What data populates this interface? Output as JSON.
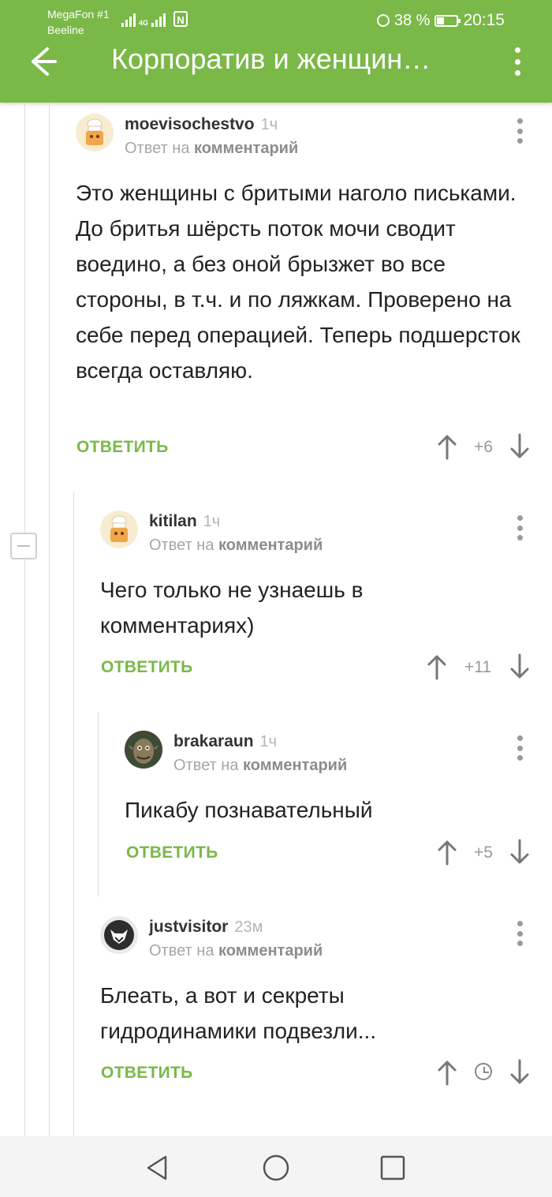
{
  "status_bar": {
    "carrier_primary": "MegaFon #1",
    "carrier_secondary": "Beeline",
    "network": "4G",
    "battery": "38 %",
    "time": "20:15"
  },
  "app_bar": {
    "title": "Корпоратив и женщин…",
    "color": "#7ab848"
  },
  "comments": [
    {
      "username": "moevisochestvo",
      "time": "1ч",
      "reply_prefix": "Ответ на",
      "reply_target": "комментарий",
      "text": "Это женщины с бритыми наголо письками. До бритья шёрсть поток мочи сводит воедино, а без оной брызжет во все стороны, в т.ч. и по ляжкам. Проверено на себе перед операцией. Теперь подшерсток всегда оставляю.",
      "reply_label": "ОТВЕТИТЬ",
      "score": "+6",
      "avatar": "chef-hat-avatar"
    },
    {
      "username": "kitilan",
      "time": "1ч",
      "reply_prefix": "Ответ на",
      "reply_target": "комментарий",
      "text": "Чего только не узнаешь в комментариях)",
      "reply_label": "ОТВЕТИТЬ",
      "score": "+11",
      "avatar": "chef-hat-avatar"
    },
    {
      "username": "brakaraun",
      "time": "1ч",
      "reply_prefix": "Ответ на",
      "reply_target": "комментарий",
      "text": "Пикабу познавательный",
      "reply_label": "ОТВЕТИТЬ",
      "score": "+5",
      "avatar": "goblin-avatar"
    },
    {
      "username": "justvisitor",
      "time": "23м",
      "reply_prefix": "Ответ на",
      "reply_target": "комментарий",
      "text": "Блеать, а вот и секреты гидродинамики подвезли...",
      "reply_label": "ОТВЕТИТЬ",
      "score": "",
      "score_icon": "clock-icon",
      "avatar": "cat-avatar"
    }
  ],
  "colors": {
    "accent": "#7ab848",
    "text": "#222222",
    "muted": "#a6a6a6"
  }
}
